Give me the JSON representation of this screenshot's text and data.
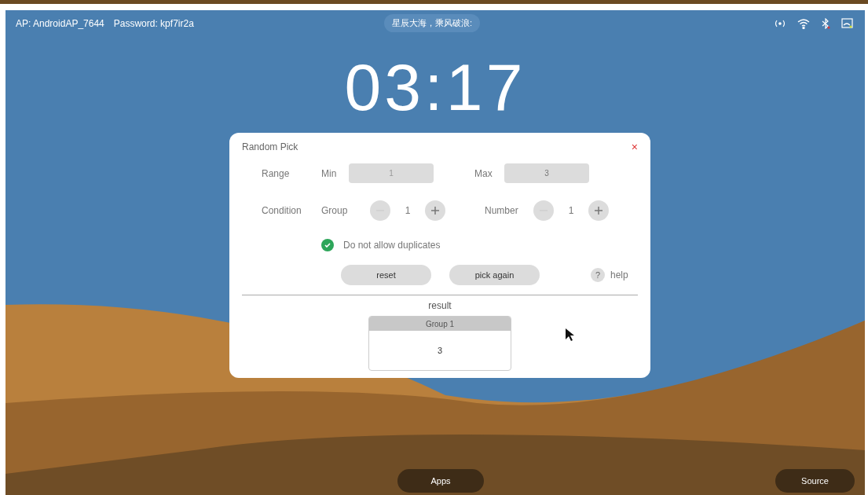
{
  "status_bar": {
    "network_info": "AP: AndroidAP_7644",
    "password_info": "Password: kpf7ir2a",
    "banner": "星辰大海，乘风破浪:"
  },
  "clock": "03:17",
  "dialog": {
    "title": "Random Pick",
    "close": "×",
    "range": {
      "label": "Range",
      "min_label": "Min",
      "min_value": "1",
      "max_label": "Max",
      "max_value": "3"
    },
    "condition": {
      "label": "Condition",
      "steppers": [
        {
          "label": "Group",
          "value": "1"
        },
        {
          "label": "Number",
          "value": "1"
        }
      ]
    },
    "no_duplicates": {
      "label": "Do not allow duplicates",
      "checked": true
    },
    "buttons": [
      "reset",
      "pick again"
    ],
    "help": {
      "icon": "?",
      "label": "help"
    },
    "result": {
      "title": "result",
      "groups": [
        {
          "name": "Group 1",
          "value": "3"
        }
      ]
    }
  },
  "dock": [
    "Apps",
    "Source"
  ]
}
